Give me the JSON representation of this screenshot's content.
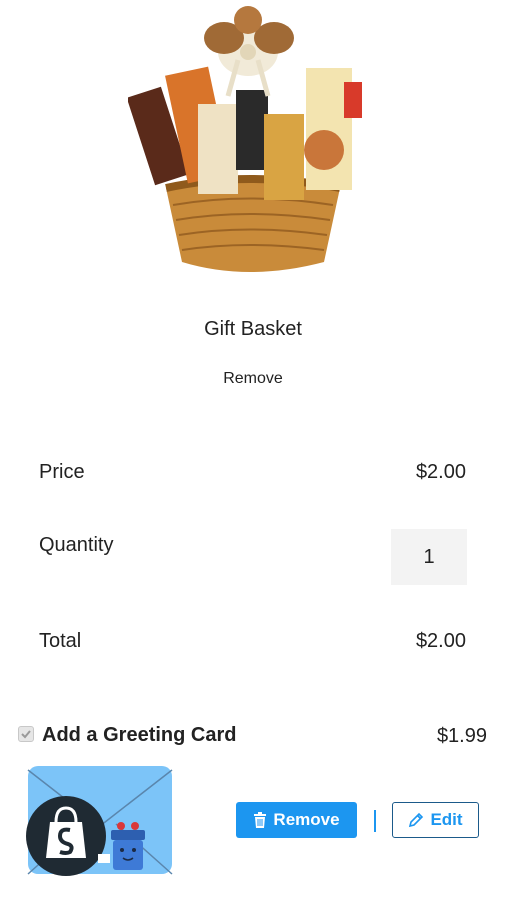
{
  "product": {
    "title": "Gift Basket",
    "remove_label": "Remove"
  },
  "summary": {
    "price_label": "Price",
    "price_value": "$2.00",
    "quantity_label": "Quantity",
    "quantity_value": "1",
    "total_label": "Total",
    "total_value": "$2.00"
  },
  "greeting_card": {
    "title": "Add a Greeting Card",
    "price": "$1.99",
    "checked": true,
    "remove_button": "Remove",
    "edit_button": "Edit"
  },
  "colors": {
    "accent": "#1c96f0",
    "card_bg": "#7cc4f8"
  }
}
